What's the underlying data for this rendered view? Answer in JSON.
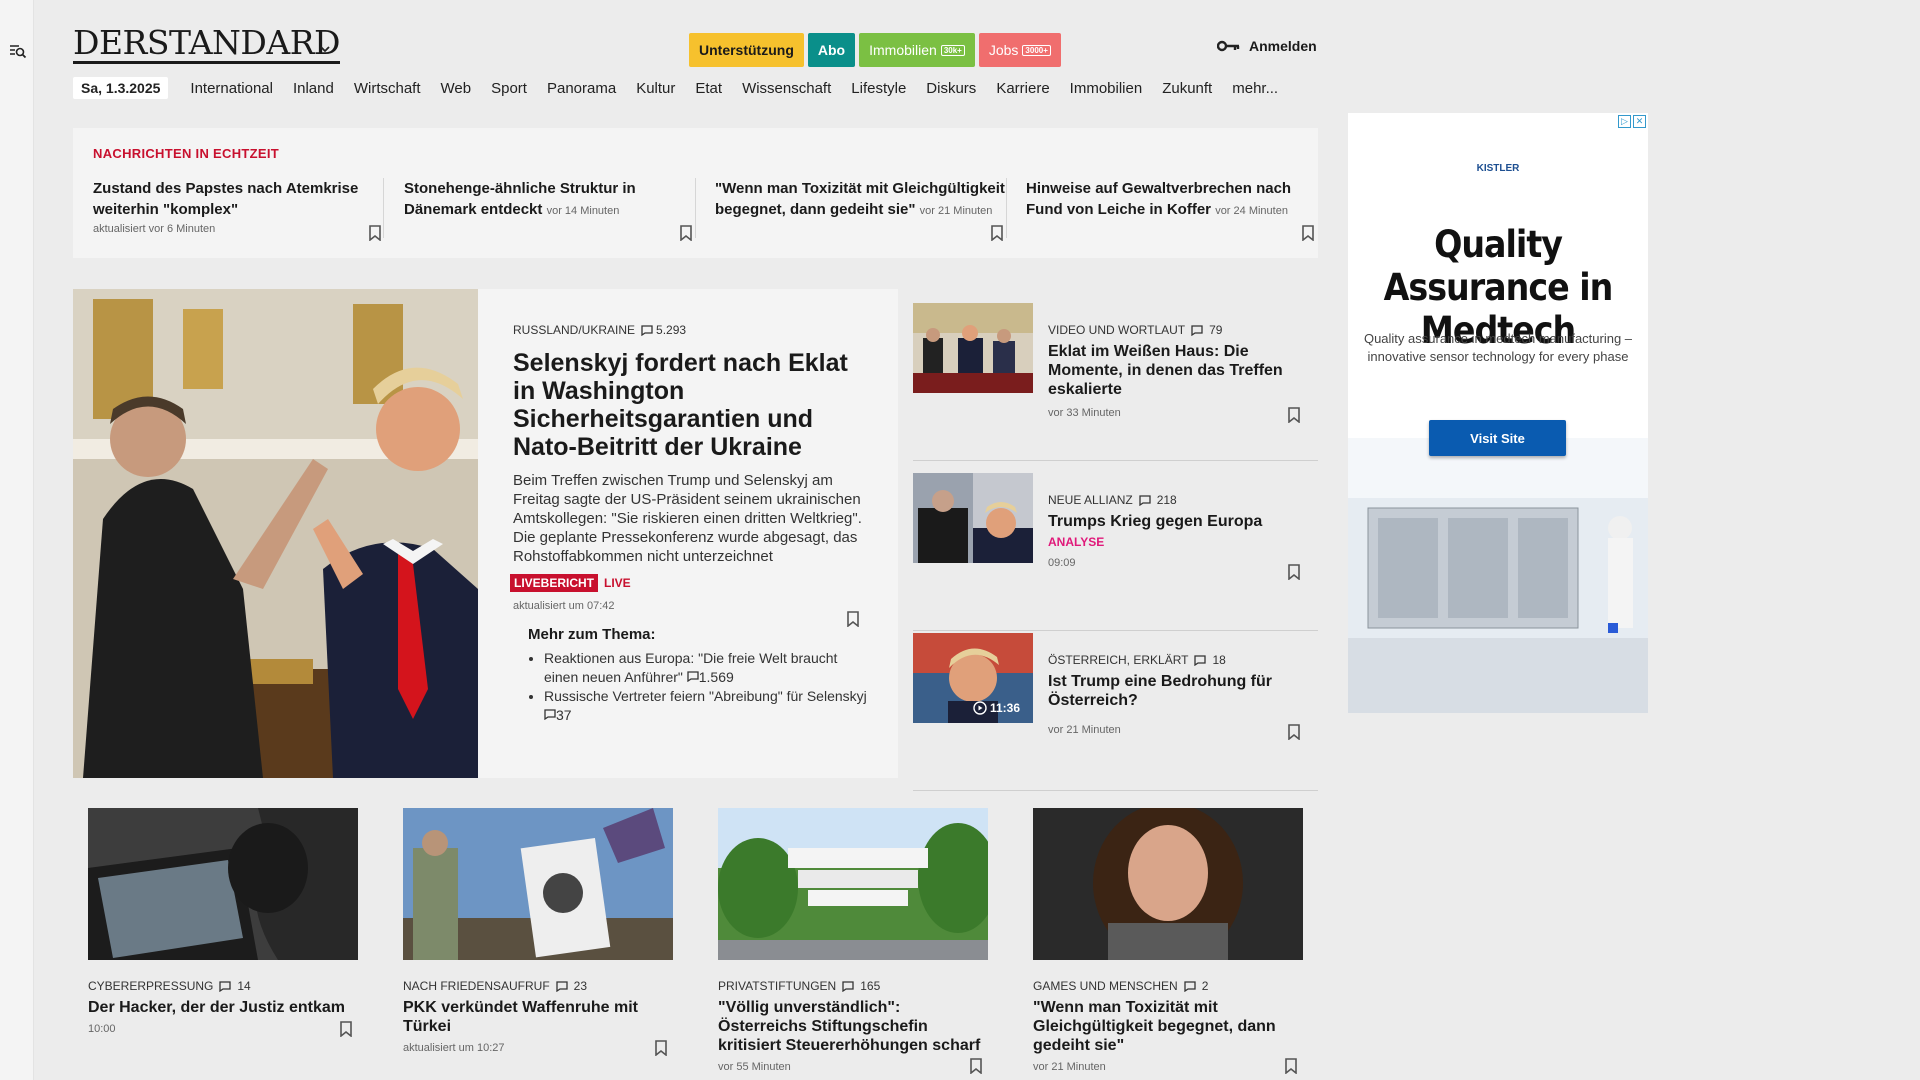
{
  "header": {
    "logo_text": "DERSTANDARD",
    "buttons": [
      {
        "label": "Unterstützung",
        "bg": "#f6c12d",
        "fg": "#1a1a1a",
        "badge": ""
      },
      {
        "label": "Abo",
        "bg": "#0a8f8a",
        "fg": "#ffffff",
        "badge": ""
      },
      {
        "label": "Immobilien",
        "bg": "#7bc043",
        "fg": "#ffffff",
        "badge": "30k+"
      },
      {
        "label": "Jobs",
        "bg": "#f06e6e",
        "fg": "#ffffff",
        "badge": "3000+"
      }
    ],
    "login_label": "Anmelden"
  },
  "nav": {
    "date": "Sa, 1.3.2025",
    "items": [
      "International",
      "Inland",
      "Wirtschaft",
      "Web",
      "Sport",
      "Panorama",
      "Kultur",
      "Etat",
      "Wissenschaft",
      "Lifestyle",
      "Diskurs",
      "Karriere",
      "Immobilien",
      "Zukunft",
      "mehr..."
    ]
  },
  "ticker": {
    "title": "NACHRICHTEN IN ECHTZEIT",
    "items": [
      {
        "headline": "Zustand des Papstes nach Atemkrise weiterhin \"komplex\"",
        "inline_time": "",
        "meta": "aktualisiert vor 6 Minuten"
      },
      {
        "headline": "Stonehenge-ähnliche Struktur in Dänemark entdeckt",
        "inline_time": "vor 14 Minuten",
        "meta": ""
      },
      {
        "headline": "\"Wenn man Toxizität mit Gleichgültigkeit begegnet, dann gedeiht sie\"",
        "inline_time": "vor 21 Minuten",
        "meta": ""
      },
      {
        "headline": "Hinweise auf Gewaltverbrechen nach Fund von Leiche in Koffer",
        "inline_time": "vor 24 Minuten",
        "meta": ""
      }
    ]
  },
  "lead": {
    "kicker": "RUSSLAND/UKRAINE",
    "comments": "5.293",
    "headline": "Selenskyj fordert nach Eklat in Washington Sicherheitsgarantien und Nato-Beitritt der Ukraine",
    "teaser": "Beim Treffen zwischen Trump und Selenskyj am Freitag sagte der US-Präsident seinem ukrainischen Amtskollegen: \"Sie riskieren einen dritten Weltkrieg\". Die geplante Pressekonferenz wurde abgesagt, das Rohstoffabkommen nicht unterzeichnet",
    "badge": "LIVEBERICHT",
    "live": "LIVE",
    "meta": "aktualisiert um 07:42",
    "more_title": "Mehr zum Thema:",
    "more_items": [
      {
        "text": "Reaktionen aus Europa: \"Die freie Welt braucht einen neuen Anführer\"",
        "comments": "1.569"
      },
      {
        "text": "Russische Vertreter feiern \"Abreibung\" für Selenskyj",
        "comments": "37"
      }
    ]
  },
  "side": [
    {
      "kicker": "VIDEO UND WORTLAUT",
      "comments": "79",
      "headline": "Eklat im Weißen Haus: Die Momente, in denen das Treffen eskalierte",
      "analysis": "",
      "time": "vor 33 Minuten",
      "duration": ""
    },
    {
      "kicker": "NEUE ALLIANZ",
      "comments": "218",
      "headline": "Trumps Krieg gegen Europa",
      "analysis": "ANALYSE",
      "time": "09:09",
      "duration": ""
    },
    {
      "kicker": "ÖSTERREICH, ERKLÄRT",
      "comments": "18",
      "headline": "Ist Trump eine Bedrohung für Österreich?",
      "analysis": "",
      "time": "vor 21 Minuten",
      "duration": "11:36"
    }
  ],
  "cards": [
    {
      "kicker": "CYBERERPRESSUNG",
      "comments": "14",
      "headline": "Der Hacker, der der Justiz entkam",
      "time": "10:00"
    },
    {
      "kicker": "NACH FRIEDENSAUFRUF",
      "comments": "23",
      "headline": "PKK verkündet Waffenruhe mit Türkei",
      "time": "aktualisiert um 10:27"
    },
    {
      "kicker": "PRIVATSTIFTUNGEN",
      "comments": "165",
      "headline": "\"Völlig unverständlich\": Österreichs Stiftungschefin kritisiert Steuererhöhungen scharf",
      "time": "vor 55 Minuten"
    },
    {
      "kicker": "GAMES UND MENSCHEN",
      "comments": "2",
      "headline": "\"Wenn man Toxizität mit Gleichgültigkeit begegnet, dann gedeiht sie\"",
      "time": "vor 21 Minuten"
    }
  ],
  "ad": {
    "brand": "KISTLER",
    "headline": "Quality Assurance in Medtech",
    "text": "Quality assurance in medtech manufacturing – innovative sensor technology for every phase",
    "cta": "Visit Site"
  }
}
